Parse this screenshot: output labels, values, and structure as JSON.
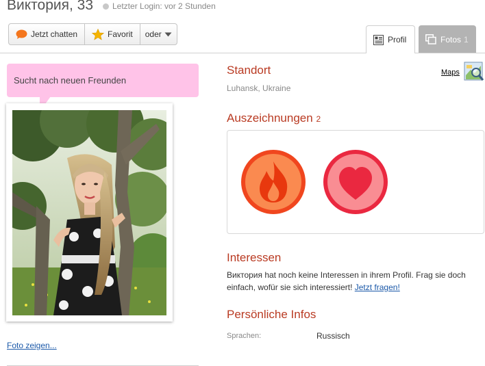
{
  "header": {
    "name": "Виктория, 33",
    "last_login": "Letzter Login: vor 2 Stunden"
  },
  "actions": {
    "chat_label": "Jetzt chatten",
    "favorite_label": "Favorit",
    "more_label": "oder"
  },
  "tabs": [
    {
      "label": "Profil",
      "icon": "profile-icon",
      "active": true
    },
    {
      "label": "Fotos",
      "count": "1",
      "icon": "photos-icon",
      "active": false
    }
  ],
  "status": {
    "text": "Sucht nach neuen Freunden"
  },
  "photo": {
    "link_label": "Foto zeigen..."
  },
  "location": {
    "heading": "Standort",
    "text": "Luhansk, Ukraine",
    "maps_label": "Maps"
  },
  "awards": {
    "heading": "Auszeichnungen",
    "count": "2",
    "items": [
      {
        "icon": "flame-icon",
        "color": "#f0461e"
      },
      {
        "icon": "heart-icon",
        "color": "#ea2840"
      }
    ]
  },
  "interests": {
    "heading": "Interessen",
    "text": "Виктория hat noch keine Interessen in ihrem Profil. Frag sie doch einfach, wofür sie sich interessiert! ",
    "link": "Jetzt fragen!"
  },
  "personal": {
    "heading": "Persönliche Infos",
    "rows": [
      {
        "label": "Sprachen:",
        "value": "Russisch"
      }
    ]
  },
  "colors": {
    "accent": "#b93a22",
    "bubble": "#ffc3e8",
    "link": "#1a58a8"
  }
}
